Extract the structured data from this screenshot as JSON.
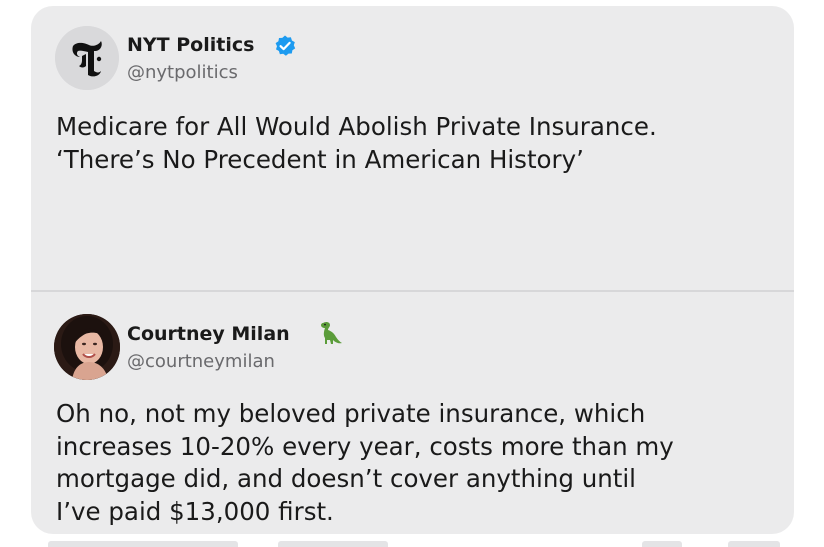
{
  "quoted_tweet": {
    "account_name": "NYT Politics",
    "handle": "@nytpolitics",
    "avatar_icon": "nyt-logo-icon",
    "verified_icon": "verified-badge-icon",
    "verified_color": "#1d9bf0",
    "text_lines": [
      "Medicare for All Would Abolish Private Insurance.",
      "‘There’s No Precedent in American History’"
    ]
  },
  "reply_tweet": {
    "account_name": "Courtney Milan",
    "handle": "@courtneymilan",
    "name_emoji_icon": "dinosaur-icon",
    "name_emoji_color": "#5b9c3a",
    "text_lines": [
      "Oh no, not my beloved private insurance, which",
      "increases 10-20% every year, costs more than my",
      "mortgage did, and doesn’t cover anything until",
      "I’ve paid $13,000 first."
    ]
  }
}
